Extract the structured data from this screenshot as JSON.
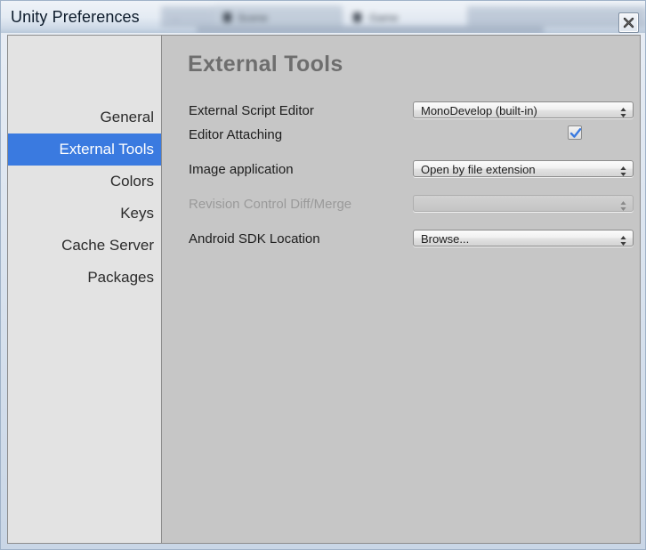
{
  "window": {
    "title": "Unity Preferences",
    "close_icon": "close-x-icon"
  },
  "background_tabs": [
    {
      "label": "Scene",
      "active": false
    },
    {
      "label": "Game",
      "active": true
    }
  ],
  "background_small_text": "...",
  "sidebar": {
    "items": [
      {
        "label": "General",
        "selected": false
      },
      {
        "label": "External Tools",
        "selected": true
      },
      {
        "label": "Colors",
        "selected": false
      },
      {
        "label": "Keys",
        "selected": false
      },
      {
        "label": "Cache Server",
        "selected": false
      },
      {
        "label": "Packages",
        "selected": false
      }
    ]
  },
  "content": {
    "title": "External Tools",
    "rows": [
      {
        "label": "External Script Editor",
        "control": "dropdown",
        "value": "MonoDevelop (built-in)",
        "disabled": false
      },
      {
        "label": "Editor Attaching",
        "control": "checkbox",
        "checked": true,
        "disabled": false
      },
      {
        "label": "Image application",
        "control": "dropdown",
        "value": "Open by file extension",
        "disabled": false
      },
      {
        "label": "Revision Control Diff/Merge",
        "control": "dropdown",
        "value": "",
        "disabled": true
      },
      {
        "label": "Android SDK Location",
        "control": "dropdown",
        "value": "Browse...",
        "disabled": false
      }
    ]
  },
  "colors": {
    "selection_blue": "#3a7ae0",
    "panel_gray": "#c6c6c6",
    "sidebar_gray": "#e3e3e3",
    "title_text": "#0d1b2b",
    "heading_gray": "#6e6e6e"
  }
}
